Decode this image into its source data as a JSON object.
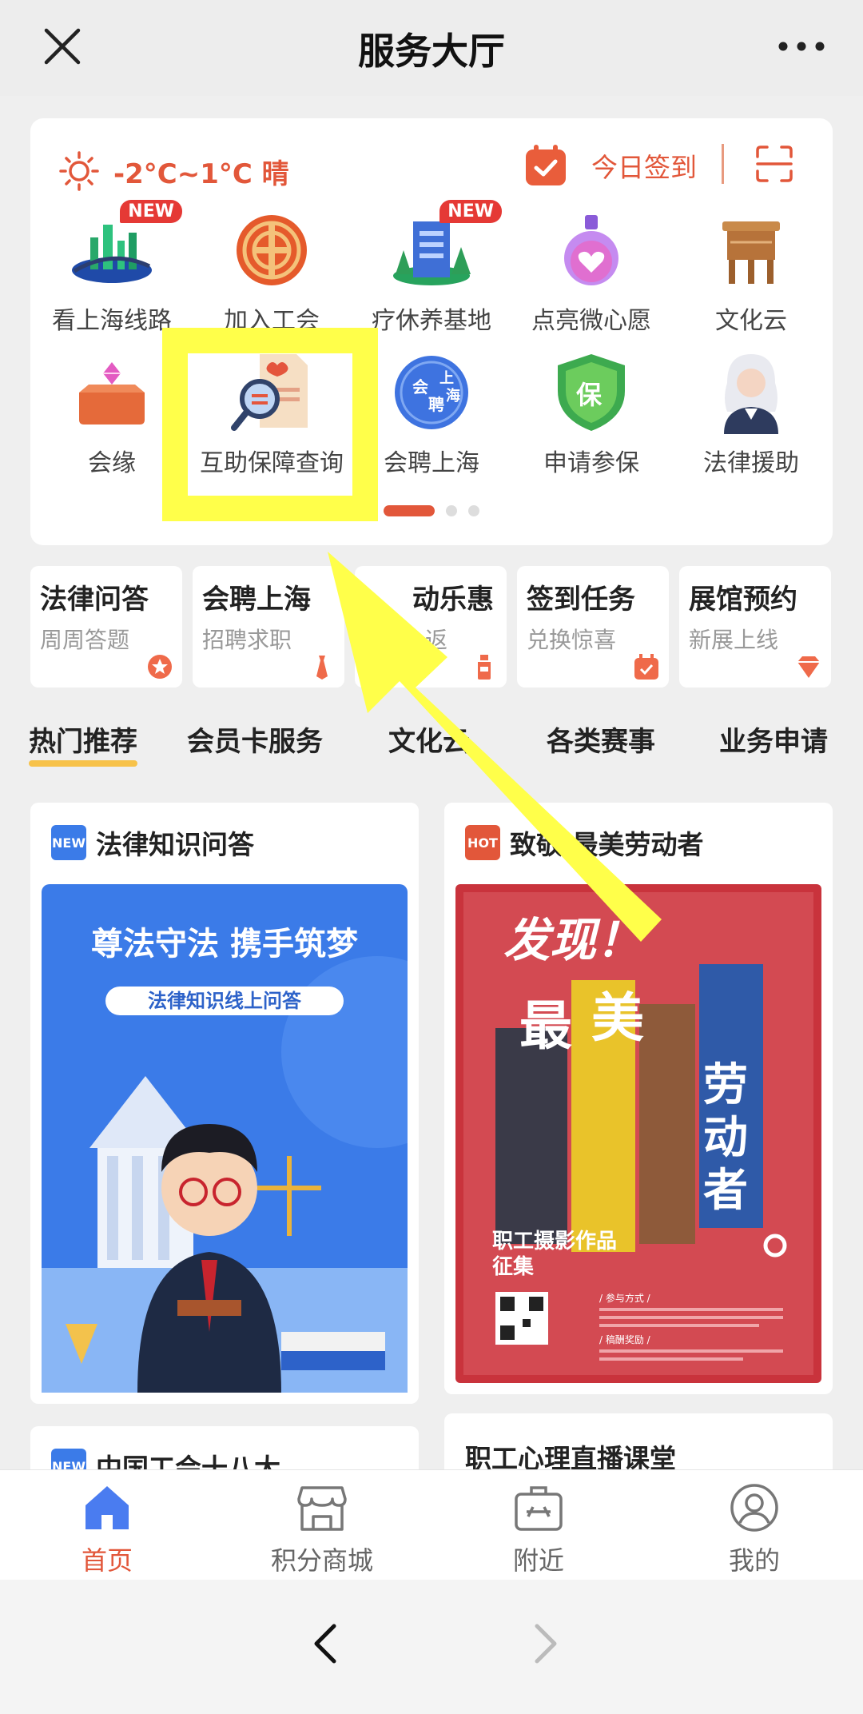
{
  "header": {
    "title": "服务大厅",
    "close_icon": "close-icon",
    "more_icon": "more-icon"
  },
  "weather": {
    "temp": "-2°C~1°C 晴",
    "icon": "sun-icon"
  },
  "signin": {
    "label": "今日签到",
    "icon": "calendar-check-icon"
  },
  "scan_icon": "scan-icon",
  "services": [
    {
      "label": "看上海线路",
      "badge": "NEW",
      "icon": "city-skyline-icon"
    },
    {
      "label": "加入工会",
      "badge": "",
      "icon": "union-emblem-icon"
    },
    {
      "label": "疗休养基地",
      "badge": "NEW",
      "icon": "building-icon"
    },
    {
      "label": "点亮微心愿",
      "badge": "",
      "icon": "potion-heart-icon"
    },
    {
      "label": "文化云",
      "badge": "",
      "icon": "bronze-vessel-icon"
    },
    {
      "label": "会缘",
      "badge": "",
      "icon": "gift-box-icon"
    },
    {
      "label": "互助保障查询",
      "badge": "",
      "icon": "document-search-icon"
    },
    {
      "label": "会聘上海",
      "badge": "",
      "icon": "recruit-globe-icon"
    },
    {
      "label": "申请参保",
      "badge": "",
      "icon": "shield-icon"
    },
    {
      "label": "法律援助",
      "badge": "",
      "icon": "judge-icon"
    }
  ],
  "quick_cards": [
    {
      "title": "法律问答",
      "subtitle": "周周答题",
      "icon": "badge-star-icon"
    },
    {
      "title": "会聘上海",
      "subtitle": "招聘求职",
      "icon": "tie-icon"
    },
    {
      "title": "动乐惠",
      "subtitle": "返",
      "icon": "bottle-icon"
    },
    {
      "title": "签到任务",
      "subtitle": "兑换惊喜",
      "icon": "calendar-icon"
    },
    {
      "title": "展馆预约",
      "subtitle": "新展上线",
      "icon": "diamond-icon"
    }
  ],
  "tabs": [
    {
      "label": "热门推荐",
      "active": true
    },
    {
      "label": "会员卡服务",
      "active": false
    },
    {
      "label": "文化云",
      "active": false
    },
    {
      "label": "各类赛事",
      "active": false
    },
    {
      "label": "业务申请",
      "active": false
    }
  ],
  "feed": {
    "card1": {
      "tag": "NEW",
      "title": "法律知识问答",
      "poster_title": "尊法守法  携手筑梦",
      "poster_subtitle": "法律知识线上问答"
    },
    "card2": {
      "tag": "HOT",
      "title": "致敬  最美劳动者",
      "poster_find": "发现！",
      "poster_big1": "最",
      "poster_big2": "美",
      "poster_side": "劳动者",
      "poster_caption1": "职工摄影作品",
      "poster_caption2": "征集",
      "poster_section1": "/ 参与方式 /",
      "poster_section2": "/ 稿酬奖励 /"
    },
    "card3": {
      "tag": "NEW",
      "title": "中国工会十八大"
    },
    "card4": {
      "title": "职工心理直播课堂"
    }
  },
  "bottom_nav": [
    {
      "label": "首页",
      "icon": "home-icon",
      "active": true
    },
    {
      "label": "积分商城",
      "icon": "store-icon",
      "active": false
    },
    {
      "label": "附近",
      "icon": "toolbox-icon",
      "active": false
    },
    {
      "label": "我的",
      "icon": "user-icon",
      "active": false
    }
  ],
  "colors": {
    "accent": "#e2573a",
    "highlight": "#ffff4a",
    "tab_underline": "#f7c24a"
  }
}
